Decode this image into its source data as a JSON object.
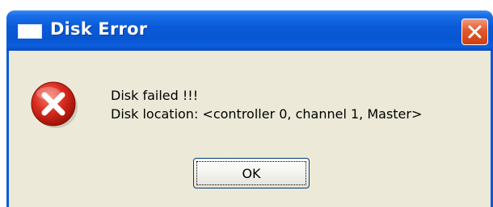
{
  "window": {
    "title": "Disk Error",
    "title_icon": "window-icon",
    "close_icon": "close-icon"
  },
  "message": {
    "icon": "error-icon",
    "line1": "Disk failed !!!",
    "line2": "Disk location:  <controller 0, channel 1, Master>"
  },
  "buttons": {
    "ok_label": "OK"
  },
  "colors": {
    "titlebar": "#0a5ad8",
    "body": "#ece9d8",
    "close_button": "#e2582c",
    "error_icon": "#d62b1f"
  }
}
